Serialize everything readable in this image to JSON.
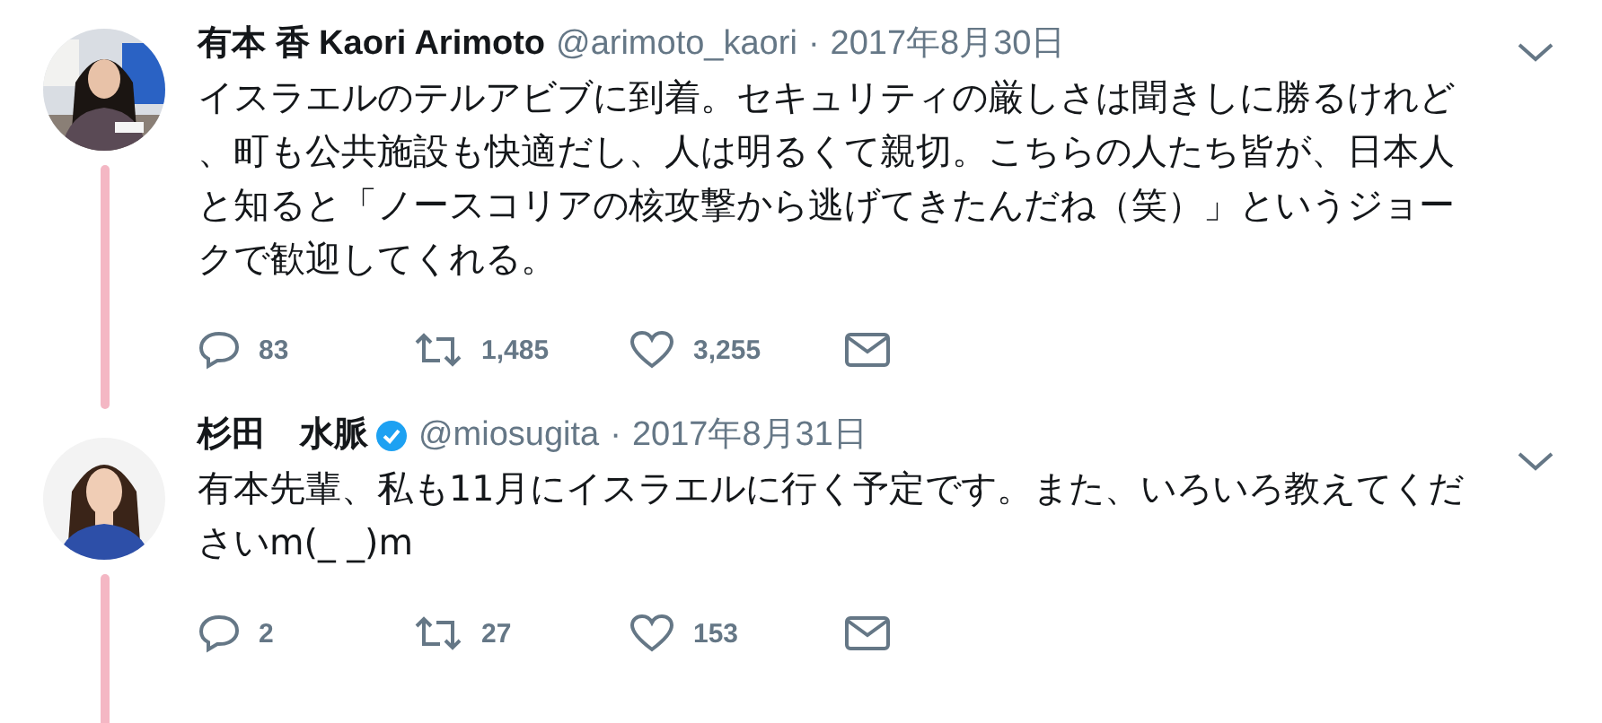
{
  "tweets": [
    {
      "name": "有本 香 Kaori Arimoto",
      "verified": false,
      "handle": "@arimoto_kaori",
      "separator": "·",
      "date": "2017年8月30日",
      "text": "イスラエルのテルアビブに到着。セキュリティの厳しさは聞きしに勝るけれど、町も公共施設も快適だし、人は明るくて親切。こちらの人たち皆が、日本人と知ると「ノースコリアの核攻撃から逃げてきたんだね（笑）」というジョークで歓迎してくれる。",
      "replies": "83",
      "retweets": "1,485",
      "likes": "3,255"
    },
    {
      "name": "杉田　水脈",
      "verified": true,
      "handle": "@miosugita",
      "separator": "·",
      "date": "2017年8月31日",
      "text": "有本先輩、私も11月にイスラエルに行く予定です。また、いろいろ教えてくださいm(_ _)m",
      "replies": "2",
      "retweets": "27",
      "likes": "153"
    }
  ]
}
